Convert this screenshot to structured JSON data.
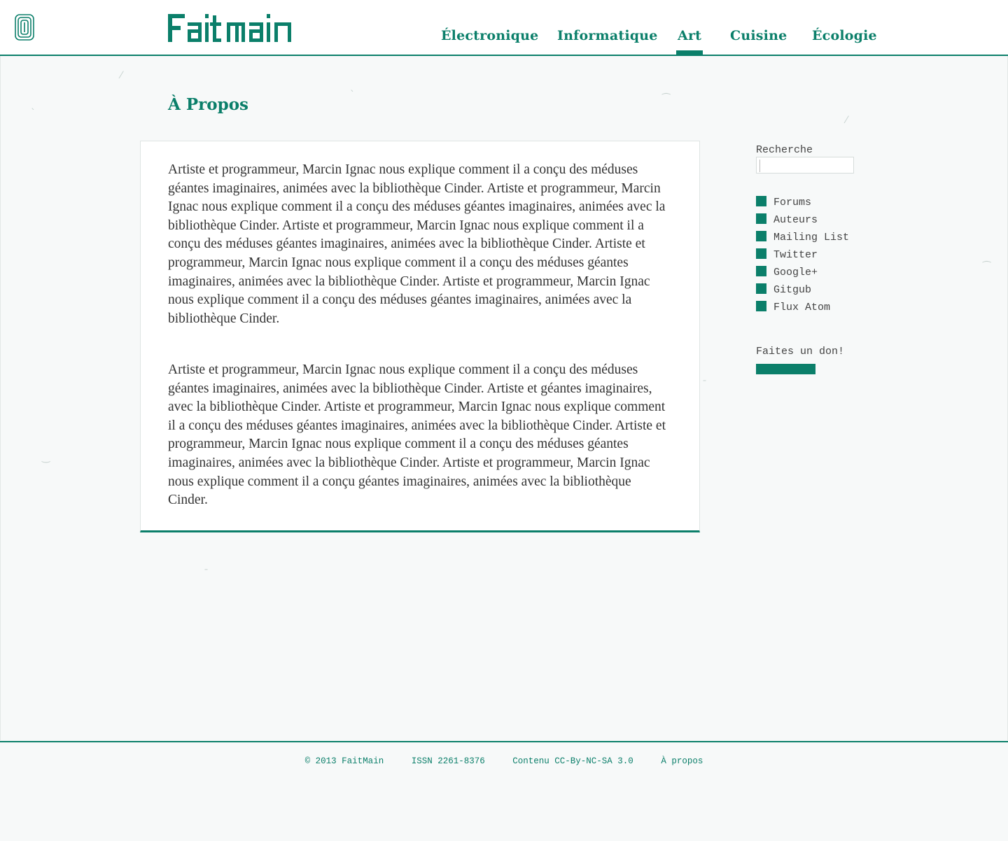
{
  "header": {
    "logo_text": "Fait main",
    "nav": [
      {
        "label": "Électronique",
        "active": false
      },
      {
        "label": "Informatique",
        "active": false
      },
      {
        "label": "Art",
        "active": true
      },
      {
        "label": "Cuisine",
        "active": false
      },
      {
        "label": "Écologie",
        "active": false
      }
    ]
  },
  "page": {
    "title": "À Propos",
    "paragraphs": [
      "Artiste et programmeur, Marcin Ignac nous explique comment il a conçu des méduses géantes imaginaires, animées avec la bibliothèque Cinder. Artiste et programmeur, Marcin Ignac nous explique comment il a conçu des méduses géantes imaginaires, animées avec la bibliothèque Cinder. Artiste et programmeur, Marcin Ignac nous explique comment il a conçu des méduses géantes imaginaires, animées avec la bibliothèque Cinder. Artiste et programmeur, Marcin Ignac nous explique comment il a conçu des méduses géantes imaginaires, animées avec la bibliothèque Cinder. Artiste et programmeur, Marcin Ignac nous explique comment il a conçu des méduses géantes imaginaires, animées avec la bibliothèque Cinder.",
      "Artiste et programmeur, Marcin Ignac nous explique comment il a conçu des méduses géantes imaginaires, animées avec la bibliothèque Cinder. Artiste et géantes imaginaires,  avec la bibliothèque Cinder. Artiste et programmeur, Marcin Ignac nous explique comment il a conçu des méduses géantes imaginaires, animées avec la bibliothèque Cinder. Artiste et programmeur, Marcin Ignac nous explique comment il a conçu des méduses géantes imaginaires, animées avec la bibliothèque Cinder. Artiste et programmeur, Marcin Ignac nous explique comment il a conçu géantes imaginaires, animées avec la bibliothèque Cinder."
    ]
  },
  "sidebar": {
    "search_label": "Recherche",
    "search_value": "",
    "links": [
      "Forums",
      "Auteurs",
      "Mailing List",
      "Twitter",
      "Google+",
      "Gitgub",
      "Flux Atom"
    ],
    "donate_label": "Faites un don!"
  },
  "footer": {
    "copyright": "© 2013 FaitMain",
    "issn": "ISSN 2261-8376",
    "license": "Contenu CC-By-NC-SA 3.0",
    "about": "À propos"
  },
  "colors": {
    "accent": "#0b7f6a",
    "background": "#f7f9f9",
    "panel": "#ffffff",
    "text": "#333333"
  }
}
